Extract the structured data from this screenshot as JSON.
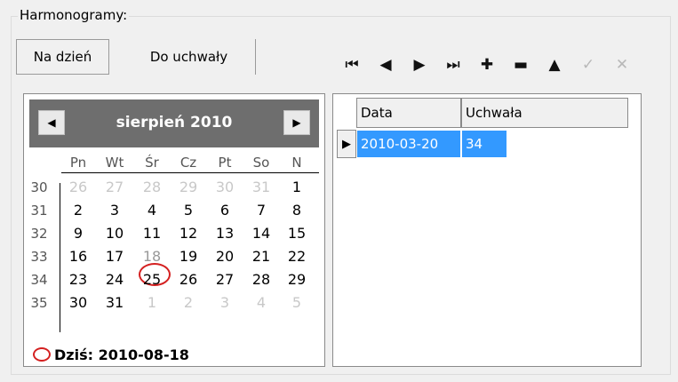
{
  "group": {
    "title": "Harmonogramy:"
  },
  "tabs": [
    {
      "label": "Na dzień",
      "active": true
    },
    {
      "label": "Do uchwały",
      "active": false
    }
  ],
  "navigator": [
    {
      "name": "first-record",
      "glyph": "⏮",
      "enabled": true
    },
    {
      "name": "prior-record",
      "glyph": "◀",
      "enabled": true
    },
    {
      "name": "next-record",
      "glyph": "▶",
      "enabled": true
    },
    {
      "name": "last-record",
      "glyph": "⏭",
      "enabled": true
    },
    {
      "name": "insert-record",
      "glyph": "✚",
      "enabled": true
    },
    {
      "name": "delete-record",
      "glyph": "▬",
      "enabled": true
    },
    {
      "name": "edit-record",
      "glyph": "▲",
      "enabled": true
    },
    {
      "name": "post-record",
      "glyph": "✓",
      "enabled": false
    },
    {
      "name": "cancel-record",
      "glyph": "✕",
      "enabled": false
    }
  ],
  "calendar": {
    "month_title": "sierpień 2010",
    "prev_glyph": "◀",
    "next_glyph": "▶",
    "weekdays": [
      "Pn",
      "Wt",
      "Śr",
      "Cz",
      "Pt",
      "So",
      "N"
    ],
    "weeks": [
      {
        "num": "30",
        "days": [
          {
            "d": "26",
            "other": true
          },
          {
            "d": "27",
            "other": true
          },
          {
            "d": "28",
            "other": true
          },
          {
            "d": "29",
            "other": true
          },
          {
            "d": "30",
            "other": true
          },
          {
            "d": "31",
            "other": true
          },
          {
            "d": "1"
          }
        ]
      },
      {
        "num": "31",
        "days": [
          {
            "d": "2"
          },
          {
            "d": "3"
          },
          {
            "d": "4"
          },
          {
            "d": "5"
          },
          {
            "d": "6"
          },
          {
            "d": "7"
          },
          {
            "d": "8"
          }
        ]
      },
      {
        "num": "32",
        "days": [
          {
            "d": "9"
          },
          {
            "d": "10"
          },
          {
            "d": "11"
          },
          {
            "d": "12"
          },
          {
            "d": "13"
          },
          {
            "d": "14"
          },
          {
            "d": "15"
          }
        ]
      },
      {
        "num": "33",
        "days": [
          {
            "d": "16"
          },
          {
            "d": "17"
          },
          {
            "d": "18",
            "today": true
          },
          {
            "d": "19"
          },
          {
            "d": "20"
          },
          {
            "d": "21"
          },
          {
            "d": "22"
          }
        ]
      },
      {
        "num": "34",
        "days": [
          {
            "d": "23"
          },
          {
            "d": "24"
          },
          {
            "d": "25"
          },
          {
            "d": "26"
          },
          {
            "d": "27"
          },
          {
            "d": "28"
          },
          {
            "d": "29"
          }
        ]
      },
      {
        "num": "35",
        "days": [
          {
            "d": "30"
          },
          {
            "d": "31"
          },
          {
            "d": "1",
            "other": true
          },
          {
            "d": "2",
            "other": true
          },
          {
            "d": "3",
            "other": true
          },
          {
            "d": "4",
            "other": true
          },
          {
            "d": "5",
            "other": true
          }
        ]
      }
    ],
    "today_label": "Dziś: 2010-08-18",
    "accent": "#d42020",
    "header_bg": "#6e6e6e"
  },
  "grid": {
    "columns": [
      "Data",
      "Uchwała"
    ],
    "rows": [
      {
        "data": "2010-03-20",
        "uchwala": "34",
        "selected": true
      }
    ],
    "row_indicator": "▶",
    "selection_color": "#3399ff"
  }
}
